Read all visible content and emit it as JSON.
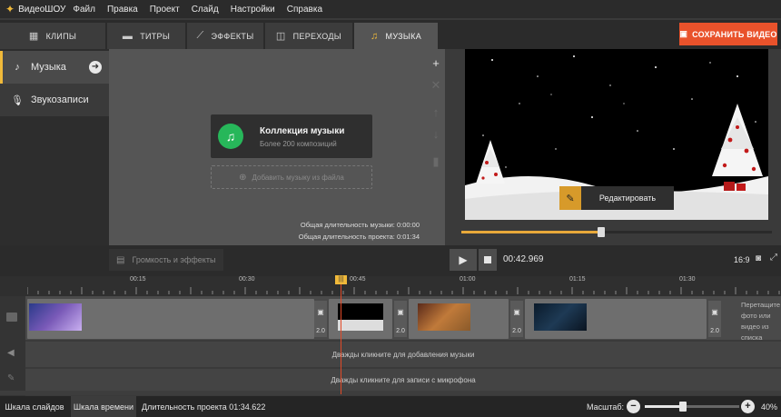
{
  "app": {
    "name": "ВидеоШОУ"
  },
  "menu": [
    "Файл",
    "Правка",
    "Проект",
    "Слайд",
    "Настройки",
    "Справка"
  ],
  "tabs": [
    {
      "label": "КЛИПЫ",
      "icon": "film-icon"
    },
    {
      "label": "ТИТРЫ",
      "icon": "speech-bubble-icon"
    },
    {
      "label": "ЭФФЕКТЫ",
      "icon": "magic-wand-icon"
    },
    {
      "label": "ПЕРЕХОДЫ",
      "icon": "transition-icon"
    },
    {
      "label": "МУЗЫКА",
      "icon": "music-note-icon",
      "active": true
    }
  ],
  "save_button": {
    "label": "СОХРАНИТЬ ВИДЕО"
  },
  "sidebar": {
    "items": [
      {
        "label": "Музыка",
        "icon": "music-file-icon",
        "active": true
      },
      {
        "label": "Звукозаписи",
        "icon": "microphone-icon"
      }
    ]
  },
  "music_panel": {
    "collection_title": "Коллекция музыки",
    "collection_subtitle": "Более 200 композиций",
    "add_from_file": "Добавить музыку из файла",
    "music_duration": "Общая длительность музыки: 0:00:00",
    "project_duration": "Общая длительность проекта: 0:01:34"
  },
  "preview": {
    "edit_label": "Редактировать",
    "progress": 0.45
  },
  "toolbar": {
    "volume_effects": "Громкость и эффекты",
    "time": "00:42.969",
    "aspect_ratio": "16:9"
  },
  "timeline": {
    "ticks": [
      "00:15",
      "00:30",
      "00:45",
      "01:00",
      "01:15",
      "01:30"
    ],
    "transitions": [
      "2.0",
      "2.0",
      "2.0",
      "2.0"
    ],
    "drop_hint": "Перетащите фото или видео из списка выше",
    "music_hint": "Дважды кликните для добавления музыки",
    "mic_hint": "Дважды кликните для записи с микрофона"
  },
  "statusbar": {
    "slides_tab": "Шкала слайдов",
    "timeline_tab": "Шкала времени",
    "project_duration": "Длительность проекта 01:34.622",
    "zoom_label": "Масштаб:",
    "zoom_value": "40%",
    "zoom_level": 0.4
  },
  "colors": {
    "accent": "#f0b93a",
    "save": "#e9522b",
    "music_green": "#27b75a",
    "playhead": "#e24a28"
  }
}
